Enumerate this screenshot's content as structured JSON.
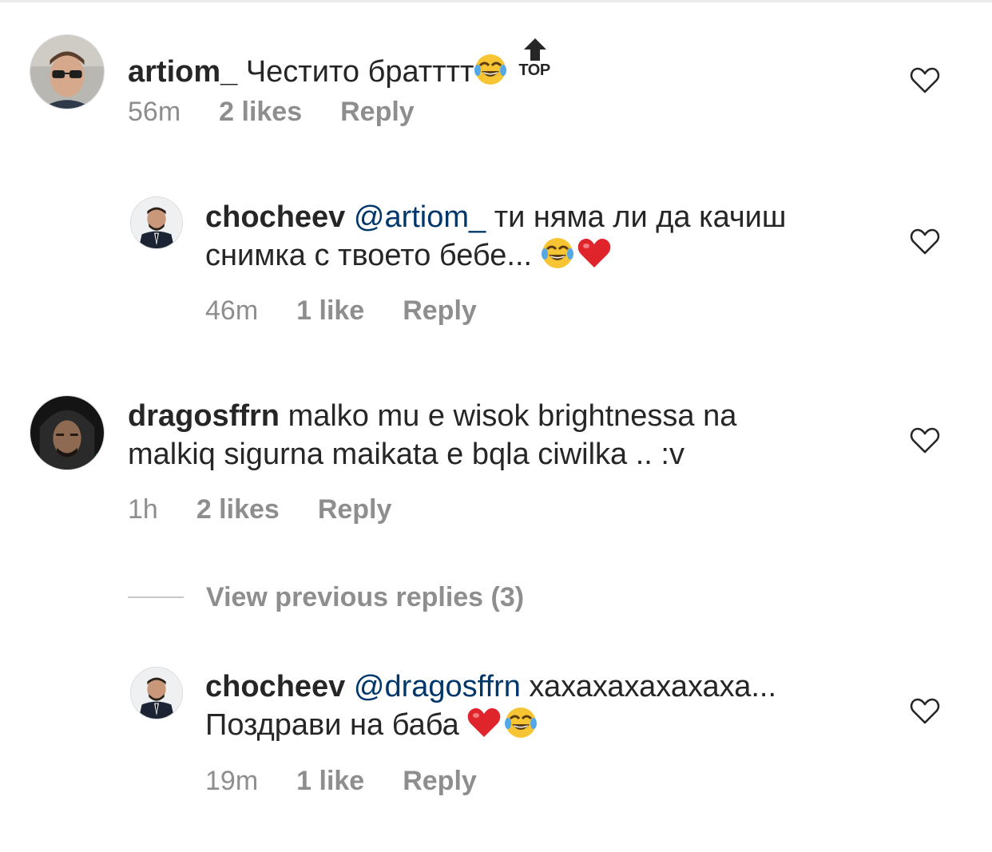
{
  "comments": [
    {
      "username": "artiom_",
      "text": "Честито братттт",
      "emoji_after": "face-with-tears-of-joy",
      "badge": "TOP",
      "time": "56m",
      "likes": "2 likes",
      "reply": "Reply"
    },
    {
      "username": "chocheev",
      "mention": "@artiom_",
      "text_line1": "ти няма ли да качиш",
      "text_line2": "снимка с твоето бебе...",
      "emoji_after": [
        "face-with-tears-of-joy",
        "red-heart"
      ],
      "time": "46m",
      "likes": "1 like",
      "reply": "Reply"
    },
    {
      "username": "dragosffrn",
      "text_line1": "malko mu e wisok brightnessa na",
      "text_line2": "malkiq sigurna maikata e bqla ciwilka .. :v",
      "time": "1h",
      "likes": "2 likes",
      "reply": "Reply"
    },
    {
      "username": "chocheev",
      "mention": "@dragosffrn",
      "text_line1": "хахахахахахаха...",
      "text_line2": "Поздрави на баба",
      "emoji_after": [
        "red-heart",
        "face-with-tears-of-joy"
      ],
      "time": "19m",
      "likes": "1 like",
      "reply": "Reply"
    }
  ],
  "view_previous_replies": "View previous replies (3)",
  "colors": {
    "text": "#262626",
    "meta": "#8e8e8e",
    "mention": "#00376b",
    "divider": "#c7c7c7"
  }
}
